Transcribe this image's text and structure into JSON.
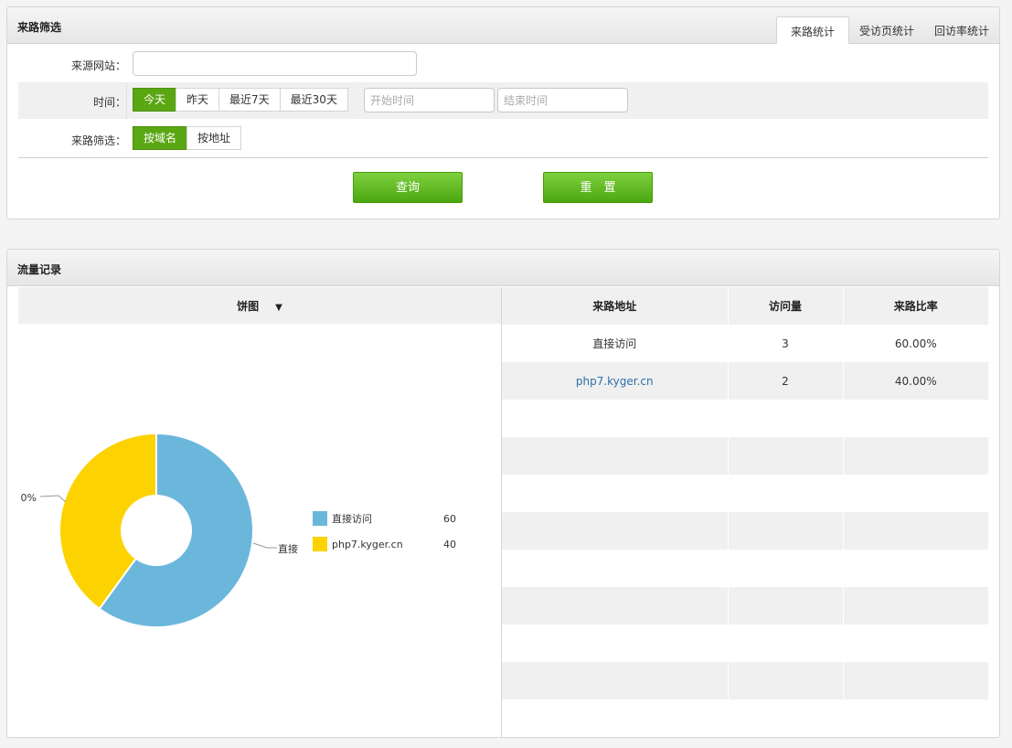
{
  "filter": {
    "title": "来路筛选",
    "tabs": [
      "来路统计",
      "受访页统计",
      "回访率统计"
    ],
    "source_label": "来源网站：",
    "source_value": "",
    "time_label": "时间：",
    "time_options": [
      "今天",
      "昨天",
      "最近7天",
      "最近30天"
    ],
    "start_placeholder": "开始时间",
    "end_placeholder": "结束时间",
    "route_label": "来路筛选：",
    "route_options": [
      "按域名",
      "按地址"
    ],
    "query_button": "查询",
    "reset_button": "重　置"
  },
  "traffic": {
    "title": "流量记录",
    "chart_selector": "饼图",
    "columns": [
      "来路地址",
      "访问量",
      "来路比率"
    ],
    "rows": [
      {
        "address": "直接访问",
        "visits": "3",
        "ratio": "60.00%",
        "link": false
      },
      {
        "address": "php7.kyger.cn",
        "visits": "2",
        "ratio": "40.00%",
        "link": true
      }
    ]
  },
  "chart_data": {
    "type": "pie",
    "categories": [
      "直接访问",
      "php7.kyger.cn"
    ],
    "values": [
      60,
      40
    ],
    "colors": [
      "#6bb7dc",
      "#fcd200"
    ],
    "outer_labels": [
      "直接",
      "0%"
    ],
    "legend": "right",
    "donut": true
  }
}
